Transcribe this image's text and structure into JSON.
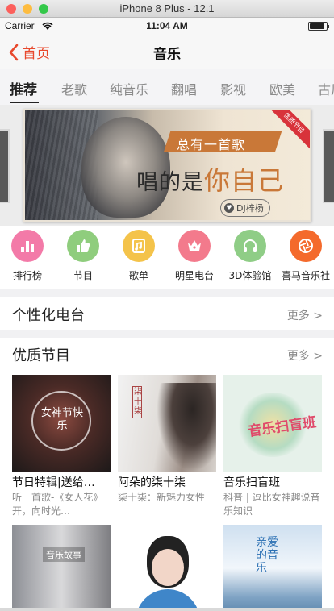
{
  "simulator": {
    "title": "iPhone 8 Plus - 12.1",
    "dot_colors": [
      "#fc605c",
      "#fdbc40",
      "#34c84a"
    ]
  },
  "status": {
    "carrier": "Carrier",
    "time": "11:04 AM",
    "battery_level": 0.9
  },
  "nav": {
    "back_label": "首页",
    "title": "音乐",
    "accent": "#e8482c"
  },
  "tabs": [
    {
      "label": "推荐",
      "active": true
    },
    {
      "label": "老歌"
    },
    {
      "label": "纯音乐"
    },
    {
      "label": "翻唱"
    },
    {
      "label": "影视"
    },
    {
      "label": "欧美"
    },
    {
      "label": "古风"
    }
  ],
  "banner": {
    "tagline": "总有一首歌",
    "headline_plain": "唱的是",
    "headline_em": "你自己",
    "author": "DJ梓杨",
    "ribbon": "优质节目"
  },
  "quick_links": [
    {
      "label": "排行榜",
      "icon": "chart-icon",
      "color": "#f37aa8"
    },
    {
      "label": "节目",
      "icon": "thumbs-up-icon",
      "color": "#8fcd7d"
    },
    {
      "label": "歌单",
      "icon": "music-note-icon",
      "color": "#f4c34a"
    },
    {
      "label": "明星电台",
      "icon": "crown-icon",
      "color": "#f37a8c"
    },
    {
      "label": "3D体验馆",
      "icon": "headphones-icon",
      "color": "#8fcd86"
    },
    {
      "label": "喜马音乐社",
      "icon": "aperture-icon",
      "color": "#f46a2c"
    }
  ],
  "sections": {
    "personal": {
      "title": "个性化电台",
      "more": "更多 >"
    },
    "quality": {
      "title": "优质节目",
      "more": "更多 >"
    }
  },
  "programs": [
    {
      "title": "节日特辑|送给…",
      "desc": "听一首歌-《女人花》开，向时光…",
      "cover_text": "女神节快乐"
    },
    {
      "title": "阿朵的柒十柒",
      "desc": "柒十柒：新魅力女性",
      "cover_text": "柒十柒"
    },
    {
      "title": "音乐扫盲班",
      "desc": "科普 | 逗比女神趣说音乐知识",
      "cover_text": "音乐扫盲班"
    },
    {
      "title": "",
      "desc": "",
      "cover_text": "音乐故事"
    },
    {
      "title": "",
      "desc": "",
      "cover_text": ""
    },
    {
      "title": "",
      "desc": "",
      "cover_text": "亲爱的音乐"
    }
  ]
}
